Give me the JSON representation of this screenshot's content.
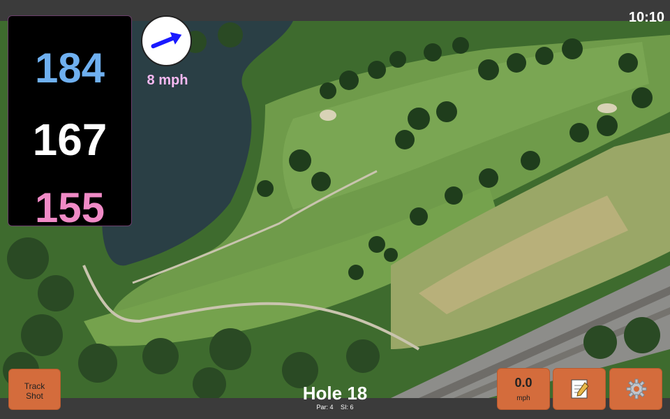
{
  "clock": "10:10",
  "distances": {
    "back": "184",
    "middle": "167",
    "front": "155"
  },
  "wind": {
    "speed_label": "8 mph",
    "arrow_icon": "wind-arrow-icon"
  },
  "buttons": {
    "track_shot_line1": "Track",
    "track_shot_line2": "Shot",
    "speed_value": "0.0",
    "speed_unit": "mph",
    "notes_icon": "notepad-icon",
    "settings_icon": "gear-icon"
  },
  "hole": {
    "title": "Hole 18",
    "par": "Par: 4",
    "si": "SI: 6"
  },
  "colors": {
    "back_distance": "#6fb0f0",
    "middle_distance": "#ffffff",
    "front_distance": "#f08ac6",
    "wind_text": "#f6b9f2",
    "button_bg": "#d46c3c"
  }
}
